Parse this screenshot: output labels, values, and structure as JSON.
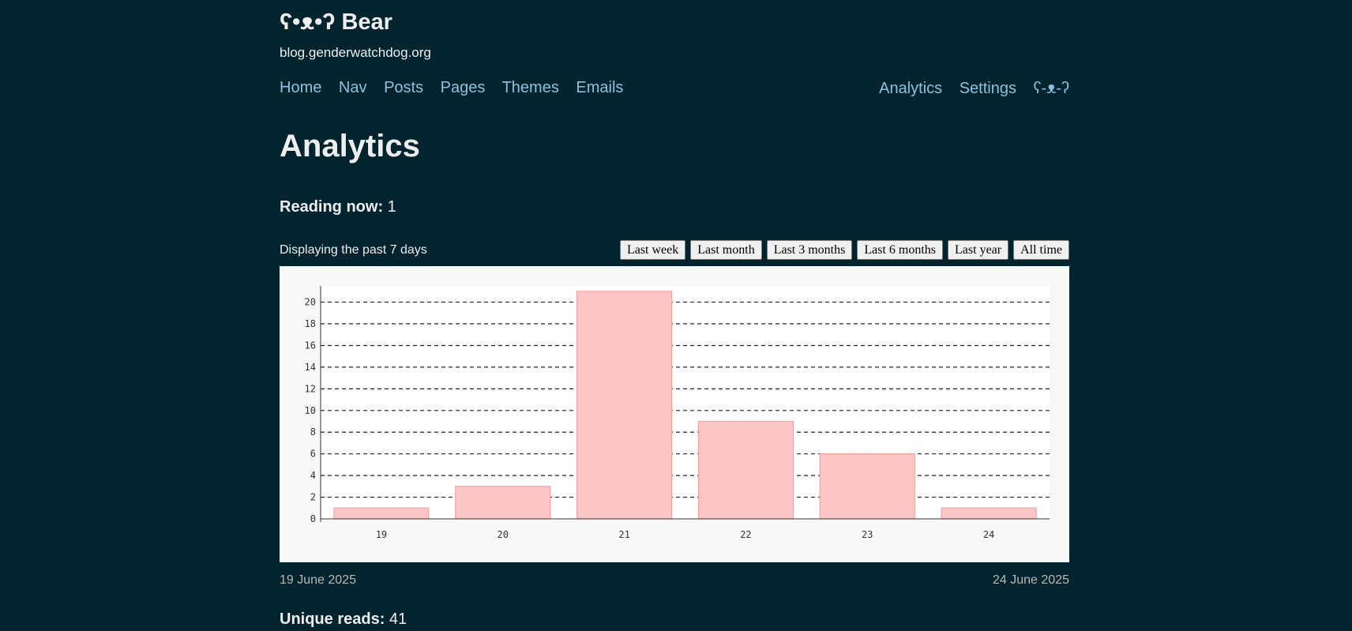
{
  "header": {
    "brand_face": "ʕ•ᴥ•ʔ",
    "brand_name": "Bear",
    "domain": "blog.genderwatchdog.org"
  },
  "nav": {
    "left": [
      "Home",
      "Nav",
      "Posts",
      "Pages",
      "Themes",
      "Emails"
    ],
    "right": [
      "Analytics",
      "Settings",
      "ʕ-ᴥ-ʔ"
    ]
  },
  "page": {
    "title": "Analytics",
    "reading_now_label": "Reading now:",
    "reading_now_value": "1",
    "display_text": "Displaying the past 7 days",
    "range_buttons": [
      "Last week",
      "Last month",
      "Last 3 months",
      "Last 6 months",
      "Last year",
      "All time"
    ],
    "start_date": "19 June 2025",
    "end_date": "24 June 2025",
    "unique_reads_label": "Unique reads:",
    "unique_reads_value": "41"
  },
  "colors": {
    "background": "#01242e",
    "link": "#8cc2dd",
    "bar_fill": "#fcc6c6",
    "bar_stroke": "#f5a3a3"
  },
  "chart_data": {
    "type": "bar",
    "categories": [
      "19",
      "20",
      "21",
      "22",
      "23",
      "24"
    ],
    "values": [
      1,
      3,
      21,
      9,
      6,
      1
    ],
    "ylim": [
      0,
      21.5
    ],
    "yticks": [
      0,
      2,
      4,
      6,
      8,
      10,
      12,
      14,
      16,
      18,
      20
    ],
    "grid": true,
    "title": "",
    "xlabel": "",
    "ylabel": ""
  }
}
